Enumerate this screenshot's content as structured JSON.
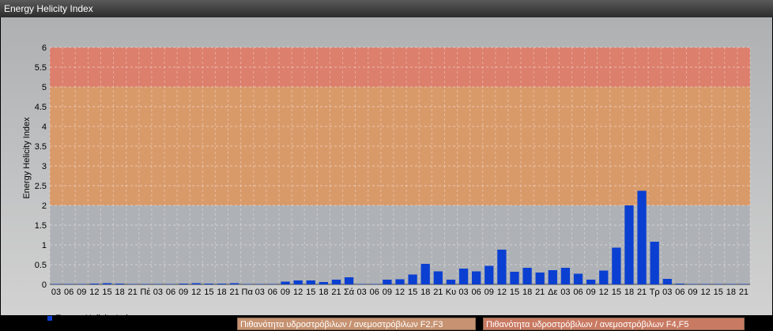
{
  "window": {
    "title": "Energy Helicity Index"
  },
  "chart_data": {
    "type": "bar",
    "ylabel": "Energy Helicity Index",
    "ylim": [
      0,
      6
    ],
    "yticks": [
      "0",
      "0.5",
      "1",
      "1.5",
      "2",
      "2.5",
      "3",
      "3.5",
      "4",
      "4.5",
      "5",
      "5.5",
      "6"
    ],
    "categories": [
      "03",
      "06",
      "09",
      "12",
      "15",
      "18",
      "21",
      "Πέ",
      "03",
      "06",
      "09",
      "12",
      "15",
      "18",
      "21",
      "Πα",
      "03",
      "06",
      "09",
      "12",
      "15",
      "18",
      "21",
      "Σά",
      "03",
      "06",
      "09",
      "12",
      "15",
      "18",
      "21",
      "Κυ",
      "03",
      "06",
      "09",
      "12",
      "15",
      "18",
      "21",
      "Δε",
      "03",
      "06",
      "09",
      "12",
      "15",
      "18",
      "21",
      "Τρ",
      "03",
      "06",
      "09",
      "12",
      "15",
      "18",
      "21"
    ],
    "series": [
      {
        "name": "Energy Helicity Index",
        "values": [
          0.01,
          0.01,
          0.01,
          0.02,
          0.03,
          0.02,
          0.01,
          0.01,
          0.01,
          0.01,
          0.02,
          0.03,
          0.02,
          0.02,
          0.03,
          0.01,
          0.01,
          0.01,
          0.07,
          0.1,
          0.1,
          0.06,
          0.12,
          0.18,
          0.01,
          0.01,
          0.12,
          0.13,
          0.25,
          0.52,
          0.33,
          0.12,
          0.4,
          0.33,
          0.47,
          0.88,
          0.32,
          0.42,
          0.3,
          0.36,
          0.42,
          0.27,
          0.12,
          0.35,
          0.93,
          2.0,
          2.37,
          1.08,
          0.14,
          0.02,
          0.01,
          0.01,
          0.01,
          0.01,
          0.01
        ],
        "color": "#0a3fd1"
      }
    ],
    "bands": [
      {
        "from": 0,
        "to": 2,
        "color": "#aeb1b5"
      },
      {
        "from": 2,
        "to": 5,
        "color": "#d99a6a"
      },
      {
        "from": 5,
        "to": 6,
        "color": "#dc7f6c"
      }
    ],
    "grid": true,
    "legend_placement": "bottom-left"
  },
  "legend": {
    "band_labels": [
      "Πιθανότητα υδροστρόβιλων / ανεμοστρόβιλων F2,F3",
      "Πιθανότητα υδροστρόβιλων / ανεμοστρόβιλων F4,F5"
    ]
  }
}
